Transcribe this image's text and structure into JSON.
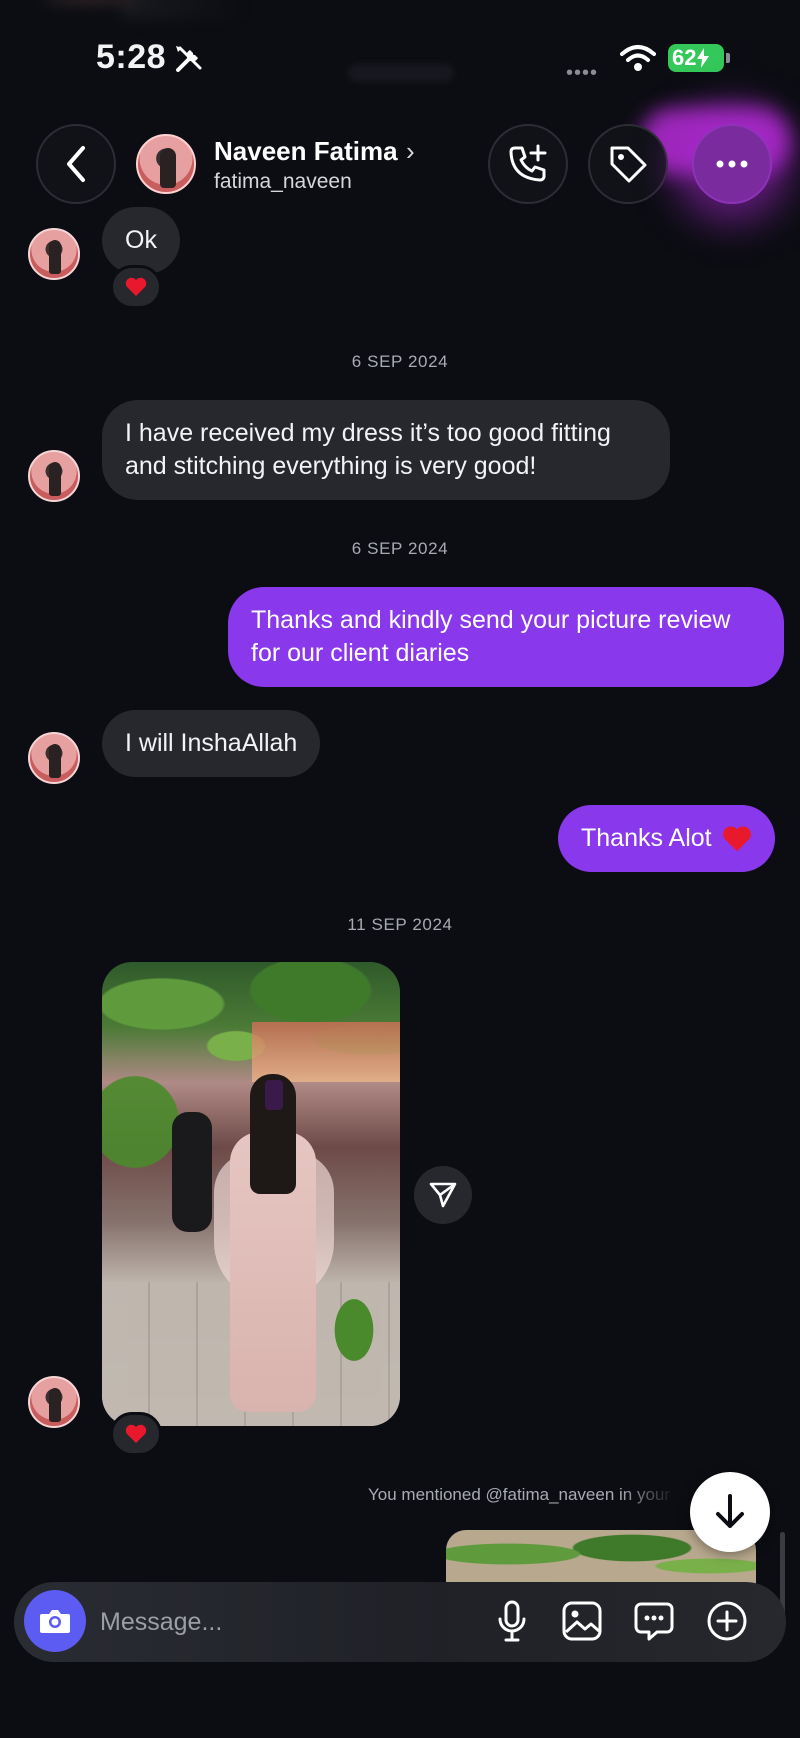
{
  "status_bar": {
    "time": "5:28",
    "battery": "62",
    "icons": [
      "tools-icon",
      "signal-dots-icon",
      "wifi-icon",
      "battery-charging-icon"
    ]
  },
  "header": {
    "back_icon": "chevron-left-icon",
    "contact_name": "Naveen Fatima",
    "name_chevron": "›",
    "contact_handle": "fatima_naveen",
    "actions": [
      "phone-plus-icon",
      "tag-icon",
      "more-horizontal-icon"
    ]
  },
  "messages": {
    "m1": {
      "direction": "incoming",
      "text": "Ok",
      "reaction": "heart"
    },
    "date1": "6 SEP 2024",
    "m2": {
      "direction": "incoming",
      "text_line1": "I have received my dress it’s too good fitting",
      "text_line2": "and stitching everything is very good!"
    },
    "date2": "6 SEP 2024",
    "m3": {
      "direction": "outgoing",
      "text_line1": "Thanks and kindly send your picture review",
      "text_line2": "for our client diaries"
    },
    "m4": {
      "direction": "incoming",
      "text": "I will InshaAllah"
    },
    "m5": {
      "direction": "outgoing",
      "text": "Thanks Alot",
      "emoji": "heart"
    },
    "date3": "11 SEP 2024",
    "m6": {
      "direction": "incoming",
      "type": "photo",
      "reaction": "heart"
    },
    "mention": "You mentioned @fatima_naveen in your story"
  },
  "composer": {
    "placeholder": "Message...",
    "icons": [
      "camera-icon",
      "microphone-icon",
      "gallery-icon",
      "sticker-icon",
      "plus-circle-icon"
    ]
  },
  "colors": {
    "background": "#0b0d12",
    "incoming_bubble": "#26282d",
    "outgoing_bubble": "#8a38ec",
    "camera_button": "#5c5cf2",
    "battery": "#34c759"
  }
}
